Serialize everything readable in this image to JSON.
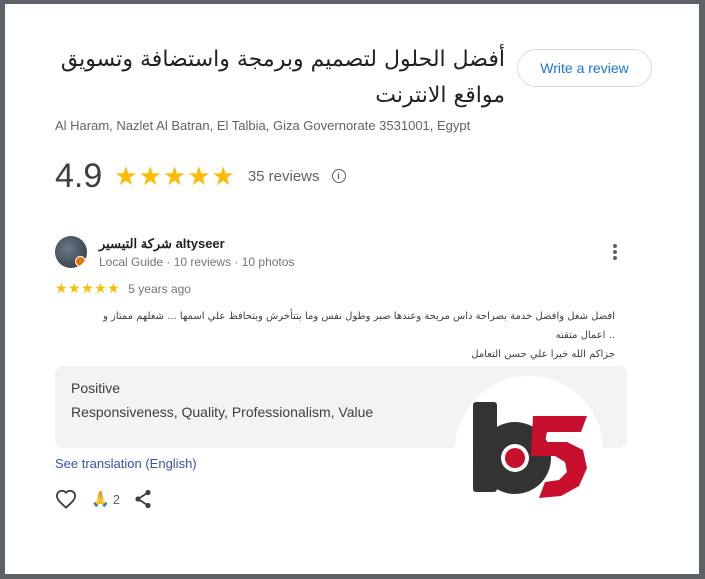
{
  "place": {
    "title": "أفضل الحلول لتصميم وبرمجة واستضافة وتسويق مواقع الانترنت",
    "address": "Al Haram, Nazlet Al Batran, El Talbia, Giza Governorate 3531001, Egypt",
    "write_review_label": "Write a review"
  },
  "rating": {
    "value": "4.9",
    "stars": "★★★★★",
    "reviews_label": "35 reviews",
    "info_glyph": "i"
  },
  "review": {
    "author": "شركة التيسير altyseer",
    "author_meta": "Local Guide · 10 reviews · 10 photos",
    "stars": "★★★★★",
    "time_ago": "5 years ago",
    "text_lines": [
      "افضل شغل وافضل خدمة بصراحة داس مريحة وعندها صبر وطول نفس وما بتتأخرش وبتحافظ علي اسمها ... شغلهم ممتاز و",
      ".. اعمال متقنه",
      "جزاكم الله خيرا علي حسن التعامل"
    ],
    "attributes_label": "Positive",
    "attributes_values": "Responsiveness, Quality, Professionalism, Value",
    "see_translation": "See translation (English)",
    "reaction_count": "2",
    "reaction_glyph": "🙏"
  },
  "colors": {
    "star": "#fbbc04",
    "link": "#1a73e8",
    "logo_dark": "#333333",
    "logo_red": "#c8102e"
  },
  "icons": [
    "info-icon",
    "more-vert-icon",
    "heart-icon",
    "share-icon"
  ]
}
